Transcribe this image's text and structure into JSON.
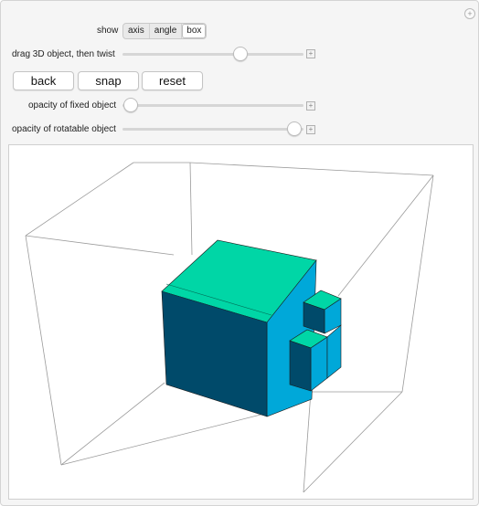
{
  "controls": {
    "show_label": "show",
    "show_options": [
      "axis",
      "angle",
      "box"
    ],
    "show_selected": "box",
    "twist_label": "drag 3D object, then twist",
    "twist_value": 0.52,
    "buttons": [
      "back",
      "snap",
      "reset"
    ],
    "opacity_fixed_label": "opacity of fixed object",
    "opacity_fixed_value": 0.0,
    "opacity_rot_label": "opacity of rotatable object",
    "opacity_rot_value": 1.0
  },
  "colors": {
    "cube_top": "#00d6a6",
    "cube_side": "#00a8d9",
    "cube_front": "#004a6a",
    "box_lines": "#9a9a9a"
  },
  "icons": {
    "corner": "plus-circle-icon",
    "slider_end": "plus-box-icon"
  }
}
